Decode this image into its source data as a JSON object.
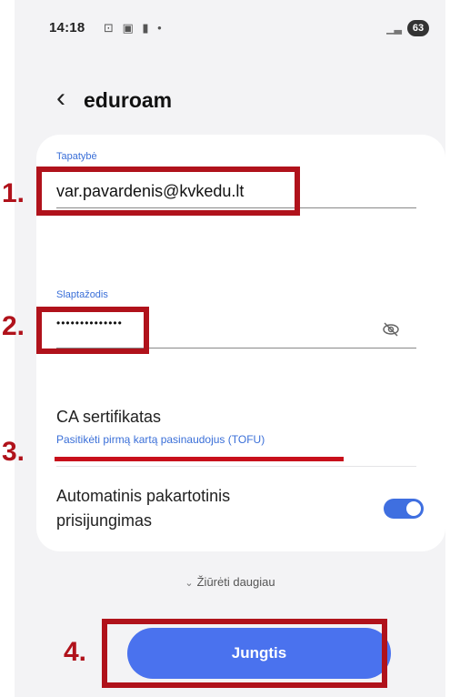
{
  "status_bar": {
    "time": "14:18",
    "notification_icons": "⊡ ▣ ▮ •",
    "signal_icon": "signal-icon",
    "battery": "63"
  },
  "header": {
    "back_icon": "‹",
    "title": "eduroam"
  },
  "form": {
    "identity_label": "Tapatybė",
    "identity_value": "var.pavardenis@kvkedu.lt",
    "password_label": "Slaptažodis",
    "password_value": "••••••••••••••",
    "ca_title": "CA sertifikatas",
    "ca_value": "Pasitikėti pirmą kartą pasinaudojus (TOFU)",
    "auto_reconnect_line1": "Automatinis pakartotinis",
    "auto_reconnect_line2": "prisijungimas",
    "auto_reconnect_on": true
  },
  "more_label": "Žiūrėti daugiau",
  "connect_label": "Jungtis",
  "annotations": {
    "step1": "1.",
    "step2": "2.",
    "step3": "3.",
    "step4": "4."
  },
  "colors": {
    "accent": "#4a72ee",
    "annotation_red": "#b0121b",
    "label_blue": "#3a6fd8"
  }
}
